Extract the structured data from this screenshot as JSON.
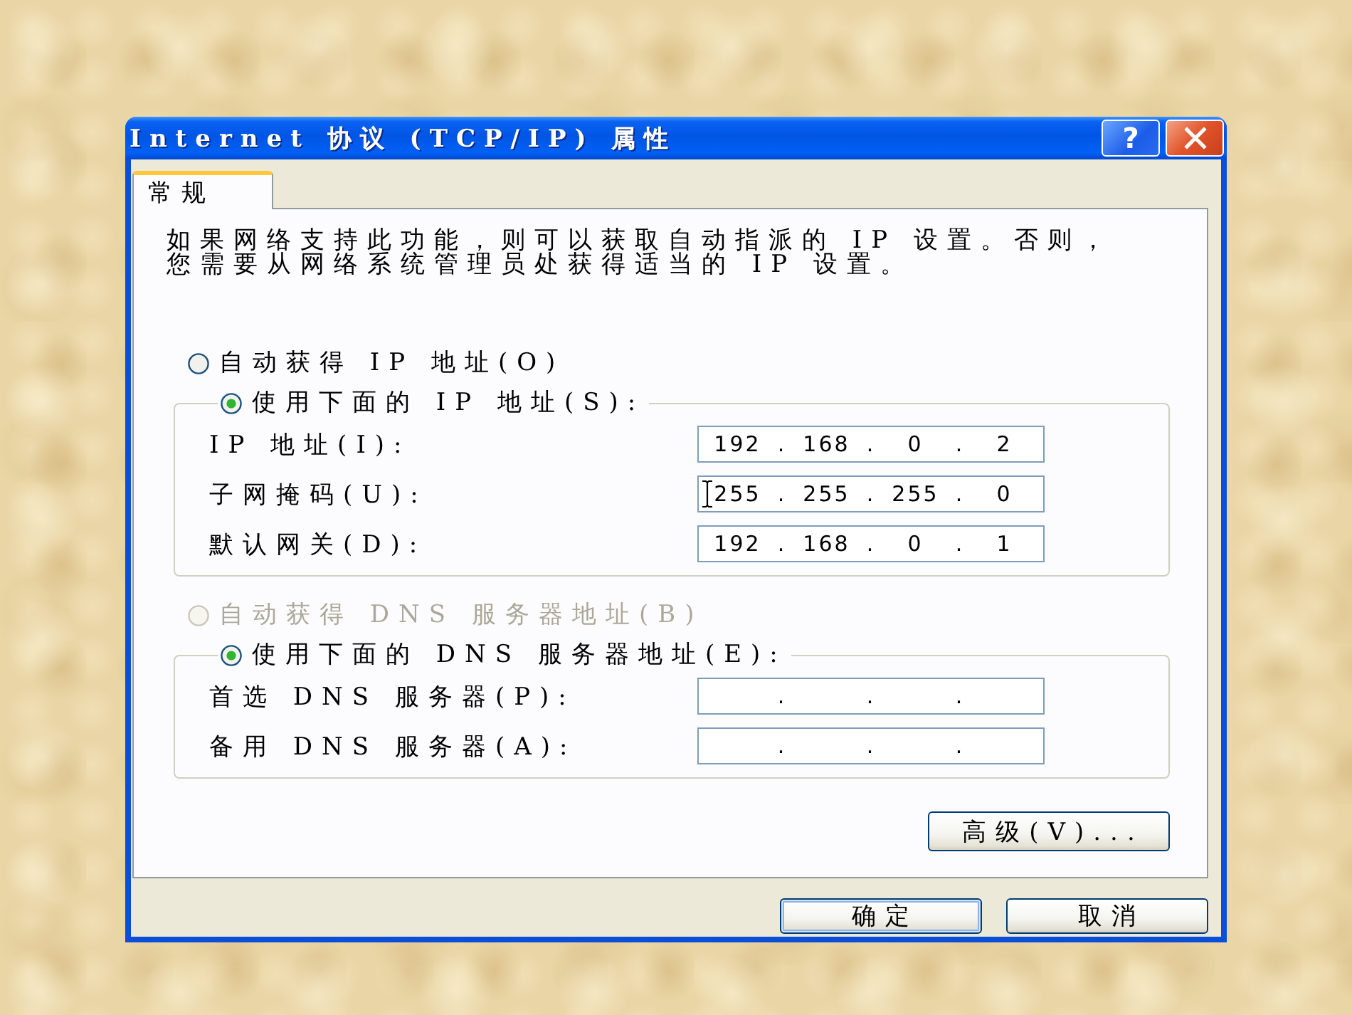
{
  "window": {
    "title": "Internet 协议 (TCP/IP) 属性",
    "help_button": "?"
  },
  "tabs": [
    {
      "label": "常规",
      "selected": true
    }
  ],
  "description": "如果网络支持此功能，则可以获取自动指派的 IP 设置。否则，您需要从网络系统管理员处获得适当的 IP 设置。",
  "ip_address": {
    "options": [
      {
        "label": "自动获得 IP 地址(O)",
        "selected": false,
        "disabled": false
      },
      {
        "label": "使用下面的 IP 地址(S):",
        "selected": true,
        "disabled": false
      }
    ],
    "fields": [
      {
        "label": "IP 地址(I):",
        "octets": [
          "192",
          "168",
          "0",
          "2"
        ],
        "separators": [
          ".",
          ".",
          "."
        ],
        "text_cursor": false
      },
      {
        "label": "子网掩码(U):",
        "octets": [
          "255",
          "255",
          "255",
          "0"
        ],
        "separators": [
          ".",
          ".",
          "."
        ],
        "text_cursor": true
      },
      {
        "label": "默认网关(D):",
        "octets": [
          "192",
          "168",
          "0",
          "1"
        ],
        "separators": [
          ".",
          ".",
          "."
        ],
        "text_cursor": false
      }
    ]
  },
  "dns_server": {
    "options": [
      {
        "label": "自动获得 DNS 服务器地址(B)",
        "selected": false,
        "disabled": true
      },
      {
        "label": "使用下面的 DNS 服务器地址(E):",
        "selected": true,
        "disabled": false
      }
    ],
    "fields": [
      {
        "label": "首选 DNS 服务器(P):",
        "separators": [
          ".",
          ".",
          "."
        ],
        "text_cursor": false
      },
      {
        "label": "备用 DNS 服务器(A):",
        "separators": [
          ".",
          ".",
          "."
        ],
        "text_cursor": false
      }
    ]
  },
  "advanced_button": "高级(V)...",
  "buttons": [
    {
      "label": "确定",
      "default": true
    },
    {
      "label": "取消",
      "default": false
    }
  ]
}
